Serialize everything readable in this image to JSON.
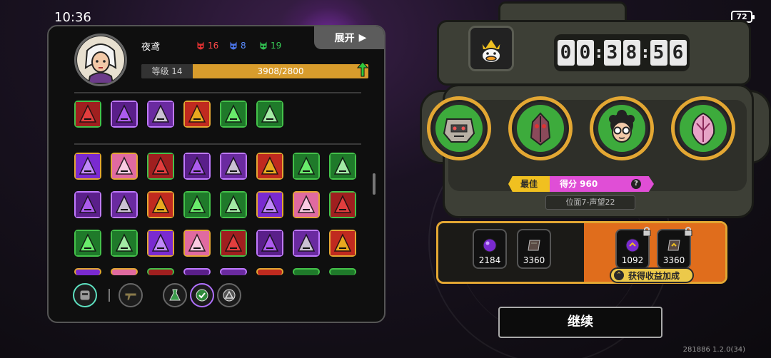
{
  "status": {
    "time": "10:36",
    "battery": "72"
  },
  "player": {
    "name": "夜鸢",
    "resources": {
      "red": "16",
      "blue": "8",
      "green": "19"
    },
    "level_label": "等级 14",
    "xp_text": "3908/2800",
    "xp_fill": 1.0
  },
  "expand_label": "展开",
  "colors": {
    "accent_gold": "#e3a733",
    "score_pink": "#e04ed6",
    "best_yellow": "#f0c020",
    "bonus_orange": "#e06d1c"
  },
  "equipment_icons": [
    "claw-item-icon",
    "green-spark-item-icon",
    "arrow-up-item-icon",
    "purple-eye-item-icon",
    "machine-item-icon",
    "green-pipe-item-icon"
  ],
  "ability_rows": [
    [
      "green-arrow-ability-icon",
      "pink-blade-ability-icon",
      "red-beast-ability-icon",
      "purple-moon-ability-icon",
      "purple-road-ability-icon",
      "yellow-slash-ability-icon",
      "green-twin-ability-icon",
      "green-plant-ability-icon"
    ],
    [
      "pillar-ability-icon",
      "red-figure-ability-icon",
      "green-swirl-ability-icon",
      "red-fang-ability-icon",
      "flame-vortex-ability-icon",
      "pink-star-ability-icon",
      "blue-lightning-ability-icon",
      "red-claws-ability-icon"
    ],
    [
      "green-shield-ability-icon",
      "fire-burst-ability-icon",
      "red-flame-ability-icon",
      "red-wave-ability-icon",
      "purple-splash-ability-icon",
      "yellow-burst-ability-icon",
      "green-spikes-ability-icon",
      "purple-rope-ability-icon"
    ]
  ],
  "timer": {
    "h1": "0",
    "h2": "0",
    "m1": "3",
    "m2": "8",
    "s1": "5",
    "s2": "6"
  },
  "characters": [
    "robot-character",
    "beetle-character",
    "glasses-boy-character",
    "pink-crystal-character"
  ],
  "best_label": "最佳",
  "score_text": "得分 960",
  "info_glyph": "?",
  "plane_text": "位面7-声望22",
  "rewards": {
    "base": [
      {
        "icon": "purple-orb",
        "value": "2184"
      },
      {
        "icon": "dark-tablet",
        "value": "3360"
      }
    ],
    "bonus": [
      {
        "icon": "purple-orb",
        "value": "1092"
      },
      {
        "icon": "dark-tablet",
        "value": "3360"
      }
    ],
    "bonus_label": "获得收益加成"
  },
  "continue_label": "继续",
  "version": "281886 1.2.0(34)"
}
